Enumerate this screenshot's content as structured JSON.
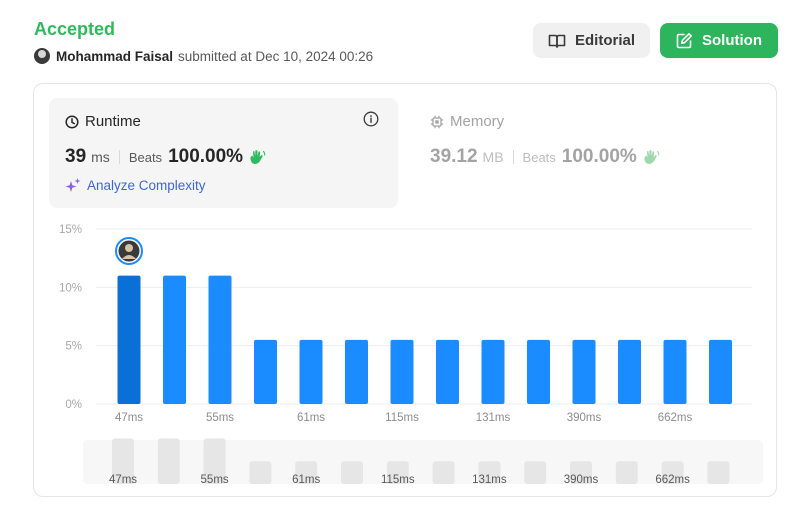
{
  "submission": {
    "status": "Accepted",
    "user": "Mohammad Faisal",
    "submitted_text": "submitted at Dec 10, 2024 00:26"
  },
  "actions": {
    "editorial_label": "Editorial",
    "solution_label": "Solution"
  },
  "runtime": {
    "title": "Runtime",
    "value": "39",
    "unit": "ms",
    "beats_label": "Beats",
    "beats_value": "100.00%",
    "analyze_label": "Analyze Complexity"
  },
  "memory": {
    "title": "Memory",
    "value": "39.12",
    "unit": "MB",
    "beats_label": "Beats",
    "beats_value": "100.00%"
  },
  "colors": {
    "accepted": "#2cbb5d",
    "solution_button": "#2db55d",
    "bar": "#1a8cff",
    "bar_selected": "#0a6fd6",
    "overview_bar": "#e6e6e6",
    "analyze": "#3f66d8"
  },
  "icons": {
    "editorial": "book-icon",
    "solution": "edit-icon",
    "runtime": "clock-icon",
    "memory": "chip-icon",
    "info": "info-icon",
    "analyze": "sparkle-icon",
    "beats": "wave-hand-icon"
  },
  "chart_data": {
    "type": "bar",
    "y_ticks": [
      "15%",
      "10%",
      "5%",
      "0%"
    ],
    "ylim": [
      0,
      15
    ],
    "x_labels": [
      "47ms",
      "55ms",
      "61ms",
      "115ms",
      "131ms",
      "390ms",
      "662ms"
    ],
    "values": [
      11,
      11,
      11,
      5.5,
      5.5,
      5.5,
      5.5,
      5.5,
      5.5,
      5.5,
      5.5,
      5.5,
      5.5,
      5.5
    ],
    "selected_index": 0,
    "grid": true
  }
}
